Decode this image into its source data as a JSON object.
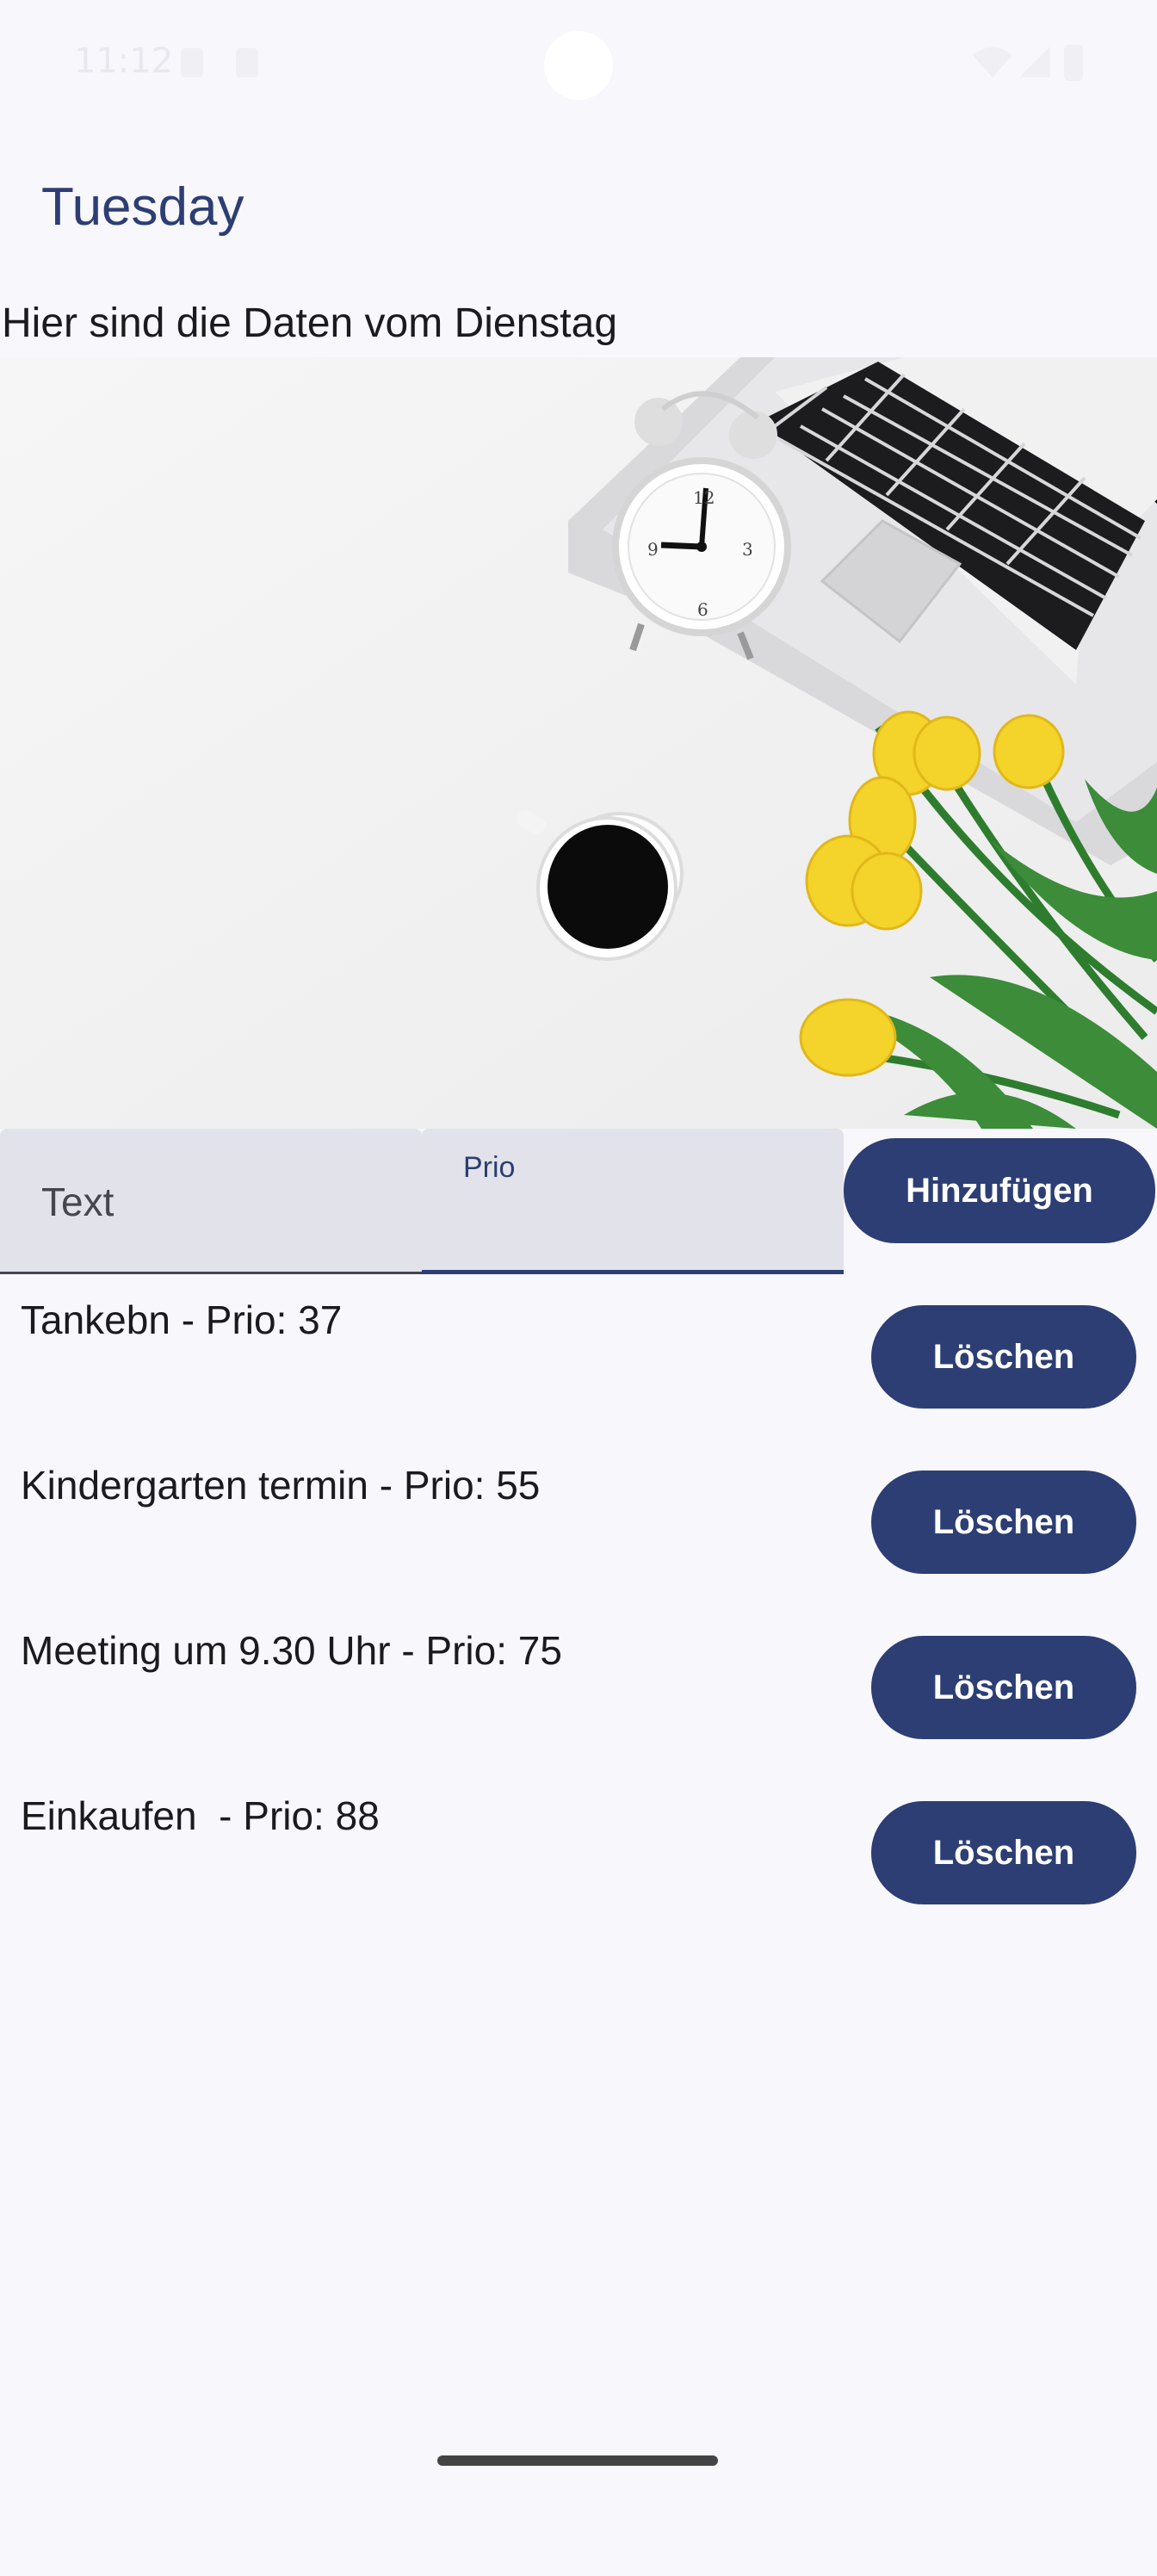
{
  "status_bar": {
    "time": "11:12"
  },
  "header": {
    "title": "Tuesday",
    "subtitle": "Hier sind die Daten vom Dienstag"
  },
  "form": {
    "text_field": {
      "placeholder": "Text",
      "value": ""
    },
    "prio_field": {
      "label": "Prio",
      "value": ""
    },
    "add_label": "Hinzufügen"
  },
  "items": [
    {
      "text": "Tankebn - Prio: 37",
      "delete_label": "Löschen"
    },
    {
      "text": "Kindergarten termin - Prio: 55",
      "delete_label": "Löschen"
    },
    {
      "text": "Meeting um 9.30 Uhr - Prio: 75",
      "delete_label": "Löschen"
    },
    {
      "text": "Einkaufen  - Prio: 88",
      "delete_label": "Löschen"
    }
  ],
  "colors": {
    "accent": "#2c3e73",
    "background": "#f8f7fc",
    "field_background": "#e2e3ea"
  }
}
